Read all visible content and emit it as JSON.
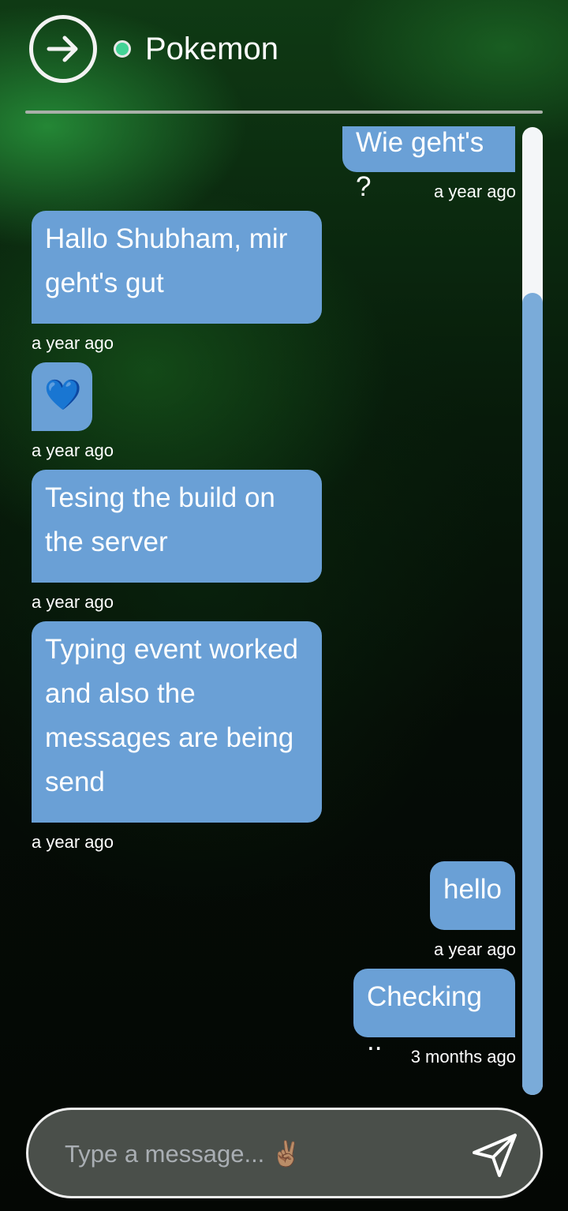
{
  "header": {
    "contact_name": "Pokemon",
    "status_color": "#43d396",
    "back_icon": "arrow-right-circle-icon"
  },
  "messages": [
    {
      "direction": "outgoing",
      "text": "Wie geht's ?",
      "time": "a year ago"
    },
    {
      "direction": "incoming",
      "text": "Hallo Shubham, mir geht's gut",
      "time": "a year ago"
    },
    {
      "direction": "incoming",
      "text": "💙",
      "time": "a year ago"
    },
    {
      "direction": "incoming",
      "text": "Tesing the build on the server",
      "time": "a year ago"
    },
    {
      "direction": "incoming",
      "text": "Typing event worked and also the messages are being send",
      "time": "a year ago"
    },
    {
      "direction": "outgoing",
      "text": "hello",
      "time": "a year ago"
    },
    {
      "direction": "outgoing",
      "text": "Checking ..",
      "time": "3 months ago"
    }
  ],
  "composer": {
    "placeholder": "Type a message... ✌🏽",
    "value": "",
    "send_icon": "send-icon"
  },
  "colors": {
    "bubble": "#6aa0d6",
    "scroll_thumb": "#7aabd9",
    "input_background": "#4a4f4a"
  }
}
